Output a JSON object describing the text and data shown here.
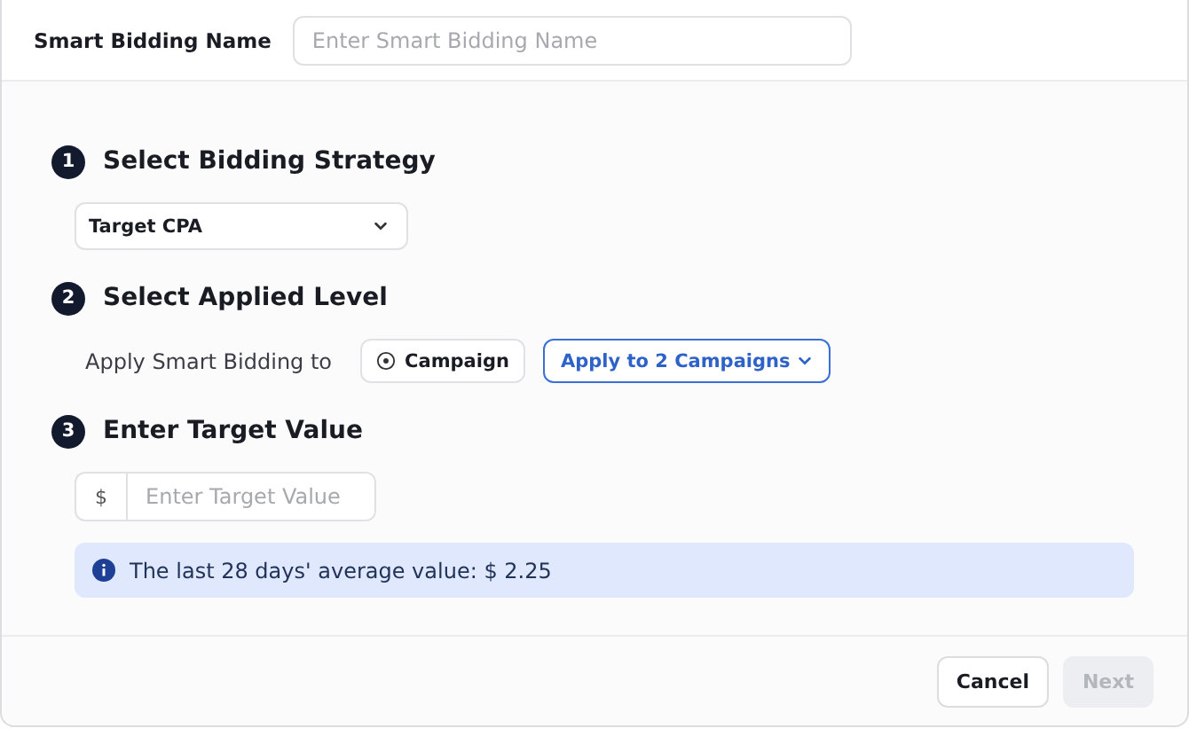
{
  "name_field": {
    "label": "Smart Bidding Name",
    "placeholder": "Enter Smart Bidding Name"
  },
  "steps": [
    {
      "number": "1",
      "title": "Select Bidding Strategy",
      "kind": "select",
      "value": "Target CPA"
    },
    {
      "number": "2",
      "title": "Select Applied Level",
      "kind": "level",
      "label": "Apply Smart Bidding to",
      "option": "Campaign",
      "menu": "Apply to 2 Campaigns"
    },
    {
      "number": "3",
      "title": "Enter Target Value",
      "kind": "value",
      "prefix": "$",
      "placeholder": "Enter Target Value",
      "info": "The last 28 days' average value: $ 2.25"
    }
  ],
  "buttons": [
    {
      "label": "Cancel",
      "disabled": false
    },
    {
      "label": "Next",
      "disabled": true
    }
  ]
}
